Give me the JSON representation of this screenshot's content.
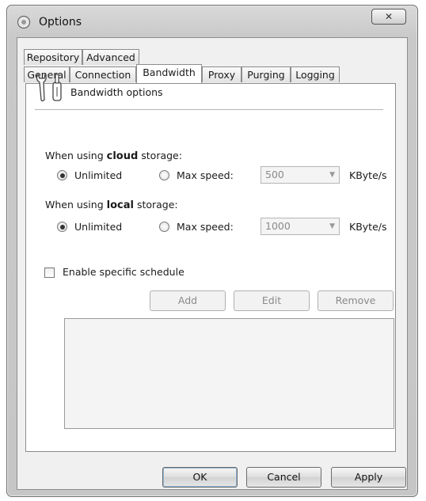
{
  "window": {
    "title": "Options",
    "close_glyph": "✕"
  },
  "tabs": {
    "row1": [
      "Repository",
      "Advanced"
    ],
    "row2": [
      "General",
      "Connection",
      "Bandwidth",
      "Proxy",
      "Purging",
      "Logging"
    ],
    "active": "Bandwidth"
  },
  "bandwidth": {
    "header_icon": "wrench-icon",
    "header_label": "Bandwidth options",
    "cloud": {
      "prefix": "When using",
      "keyword": "cloud",
      "suffix": "storage:",
      "unlimited_label": "Unlimited",
      "unlimited_selected": true,
      "max_speed_label": "Max speed:",
      "max_speed_value": "500",
      "unit": "KByte/s"
    },
    "local": {
      "prefix": "When using",
      "keyword": "local",
      "suffix": "storage:",
      "unlimited_label": "Unlimited",
      "unlimited_selected": true,
      "max_speed_label": "Max speed:",
      "max_speed_value": "1000",
      "unit": "KByte/s"
    },
    "schedule": {
      "checkbox_label": "Enable specific schedule",
      "checked": false,
      "add_label": "Add",
      "edit_label": "Edit",
      "remove_label": "Remove"
    }
  },
  "footer": {
    "ok_label": "OK",
    "cancel_label": "Cancel",
    "apply_label": "Apply"
  },
  "icons": {
    "window": "options-app-icon",
    "dropdown": "chevron-down-icon"
  }
}
